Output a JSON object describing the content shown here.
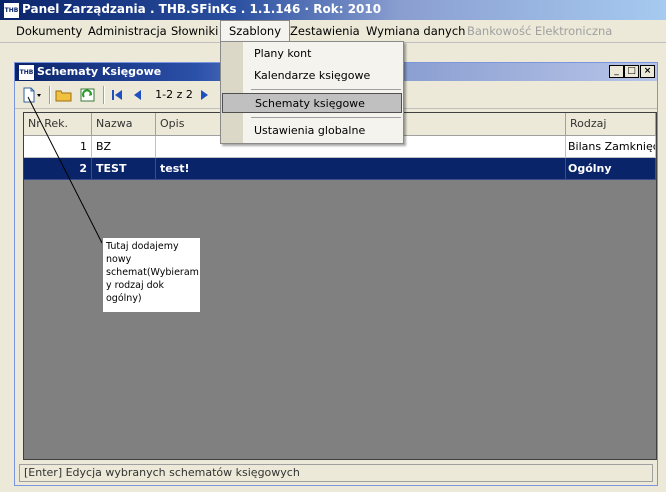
{
  "app": {
    "title": "Panel Zarządzania . THB.SFinKs . 1.1.146 · Rok: 2010",
    "icon_text": "THB"
  },
  "menubar": {
    "items": [
      {
        "label": "Dokumenty"
      },
      {
        "label": "Administracja"
      },
      {
        "label": "Słowniki"
      },
      {
        "label": "Szablony"
      },
      {
        "label": "Zestawienia"
      },
      {
        "label": "Wymiana danych"
      },
      {
        "label": "Bankowość Elektroniczna"
      }
    ],
    "active_index": 3,
    "disabled_index": 6
  },
  "dropdown": {
    "items": [
      {
        "label": "Plany kont"
      },
      {
        "label": "Kalendarze księgowe"
      },
      {
        "label": "Schematy księgowe"
      },
      {
        "label": "Ustawienia globalne"
      }
    ],
    "highlighted_index": 2
  },
  "child_window": {
    "title": "Schematy Księgowe",
    "icon_text": "THB",
    "buttons": {
      "minimize": "_",
      "restore": "□",
      "close": "×"
    }
  },
  "toolbar": {
    "icons": [
      "new-document-icon",
      "open-folder-icon",
      "refresh-icon",
      "first-record-icon",
      "previous-record-icon",
      "next-record-icon"
    ],
    "record_counter": "1-2 z 2"
  },
  "grid": {
    "columns": [
      "Nr Rek.",
      "Nazwa",
      "Opis",
      "Rodzaj"
    ],
    "rows": [
      {
        "nr": "1",
        "nazwa": "BZ",
        "opis": "",
        "rodzaj": "Bilans Zamknięcia",
        "selected": false
      },
      {
        "nr": "2",
        "nazwa": "TEST",
        "opis": "test!",
        "rodzaj": "Ogólny",
        "selected": true
      }
    ]
  },
  "status_bar": {
    "text": "[Enter] Edycja wybranych schematów księgowych"
  },
  "annotation": {
    "text": "Tutaj dodajemy nowy schemat(Wybieram y rodzaj dok ogólny)"
  },
  "colors": {
    "title_bar": "#0a246a",
    "selection": "#0a246a",
    "grid_background": "#808080",
    "window_background": "#ece9d8"
  }
}
